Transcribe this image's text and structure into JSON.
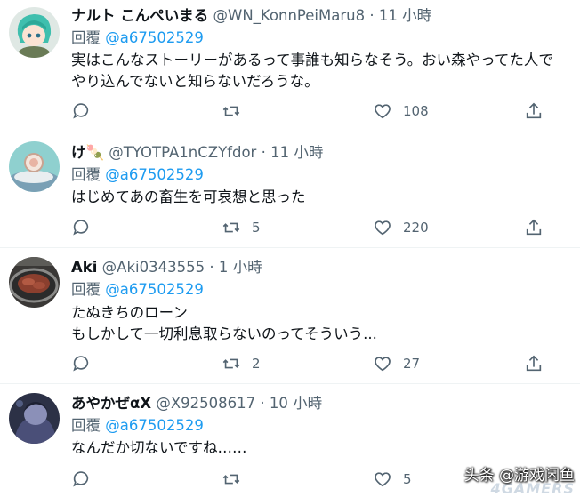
{
  "reply_label": "回覆",
  "tweets": [
    {
      "display_name": "ナルト こんぺいまる",
      "handle": "@WN_KonnPeiMaru8",
      "sep": "·",
      "time": "11 小時",
      "mention": "@a67502529",
      "lines": [
        "実はこんなストーリーがあるって事誰も知らなそう。おい森やってた人で",
        "やり込んでないと知らないだろうな。"
      ],
      "stats": {
        "replies": "",
        "retweets": "",
        "likes": "108"
      }
    },
    {
      "display_name": "け",
      "name_emoji": "🍡",
      "handle": "@TYOTPA1nCZYfdor",
      "sep": "·",
      "time": "11 小時",
      "mention": "@a67502529",
      "lines": [
        "はじめてあの畜生を可哀想と思った"
      ],
      "stats": {
        "replies": "",
        "retweets": "5",
        "likes": "220"
      }
    },
    {
      "display_name": "Aki",
      "handle": "@Aki0343555",
      "sep": "·",
      "time": "1 小時",
      "mention": "@a67502529",
      "lines": [
        "たぬきちのローン",
        "もしかして一切利息取らないのってそういう..."
      ],
      "stats": {
        "replies": "",
        "retweets": "2",
        "likes": "27"
      }
    },
    {
      "display_name": "あやかぜαX",
      "handle": "@X92508617",
      "sep": "·",
      "time": "10 小時",
      "mention": "@a67502529",
      "lines": [
        "なんだか切ないですね……"
      ],
      "stats": {
        "replies": "",
        "retweets": "",
        "likes": "5"
      }
    }
  ],
  "watermark": "头条 @游戏闲鱼",
  "watermark_logo": "4GAMERS",
  "colors": {
    "accent": "#1d9bf0",
    "secondary_text": "#536471",
    "primary_text": "#0f1419",
    "divider": "#eff3f4"
  },
  "icons": [
    "reply-icon",
    "retweet-icon",
    "like-icon",
    "share-icon"
  ]
}
